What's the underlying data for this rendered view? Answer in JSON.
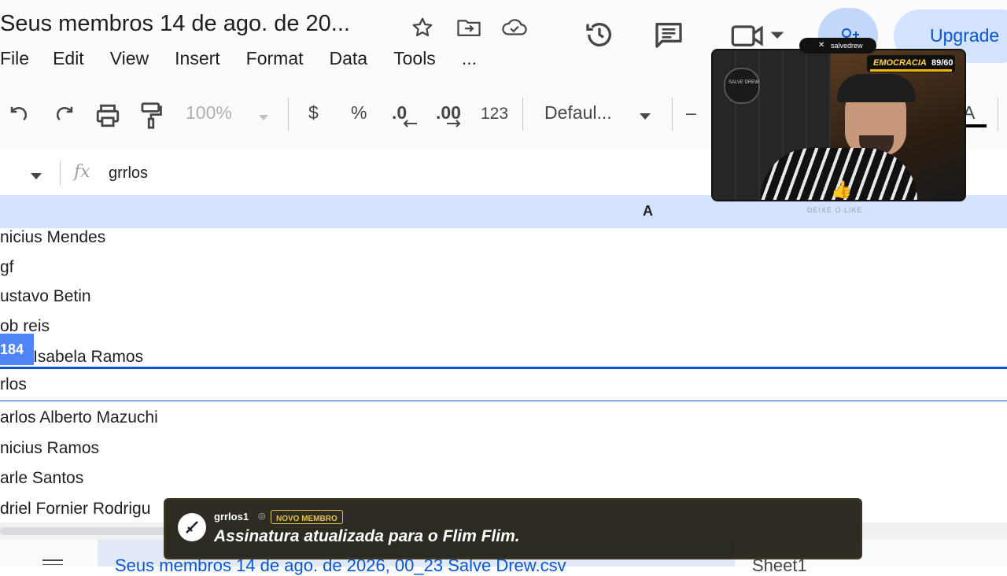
{
  "header": {
    "doc_title": "Seus membros 14 de ago. de 20...",
    "upgrade_label": "Upgrade",
    "menu": [
      "File",
      "Edit",
      "View",
      "Insert",
      "Format",
      "Data",
      "Tools",
      "..."
    ]
  },
  "toolbar": {
    "zoom": "100%",
    "currency": "$",
    "percent": "%",
    "decrease_decimal": ".0",
    "increase_decimal": ".00",
    "more_formats": "123",
    "font": "Defaul...",
    "minus": "–",
    "text_color_letter": "A"
  },
  "formula_bar": {
    "fx": "fx",
    "value": "grrlos"
  },
  "sheet": {
    "column_header": "A",
    "rows": [
      "nicius Mendes",
      "gf",
      "ustavo Betin",
      "ob reis",
      "Isabela Ramos",
      "rlos",
      "arlos Alberto Mazuchi",
      "nicius Ramos",
      "arle Santos",
      "driel Fornier Rodrigu"
    ],
    "row_tooltip": "184"
  },
  "sheet_bar": {
    "file_tab": "Seus membros 14 de ago. de 2026, 00_23 Salve Drew.csv",
    "sheet_tab": "Sheet1"
  },
  "webcam": {
    "channel": "salvedrew",
    "logo_text": "SALVE DREW",
    "meter_label": "EMOCRACIA",
    "meter_value": "89/60",
    "caption": "DEIXE O LIKE"
  },
  "notification": {
    "username": "grrlos1",
    "badge": "NOVO MEMBRO",
    "message": "Assinatura atualizada para o Flim Flim."
  },
  "colors": {
    "accent": "#0b57d0",
    "header_bg": "#f9fbfd",
    "column_header_bg": "#d3e3fd",
    "notification_badge": "#e2c24a"
  }
}
